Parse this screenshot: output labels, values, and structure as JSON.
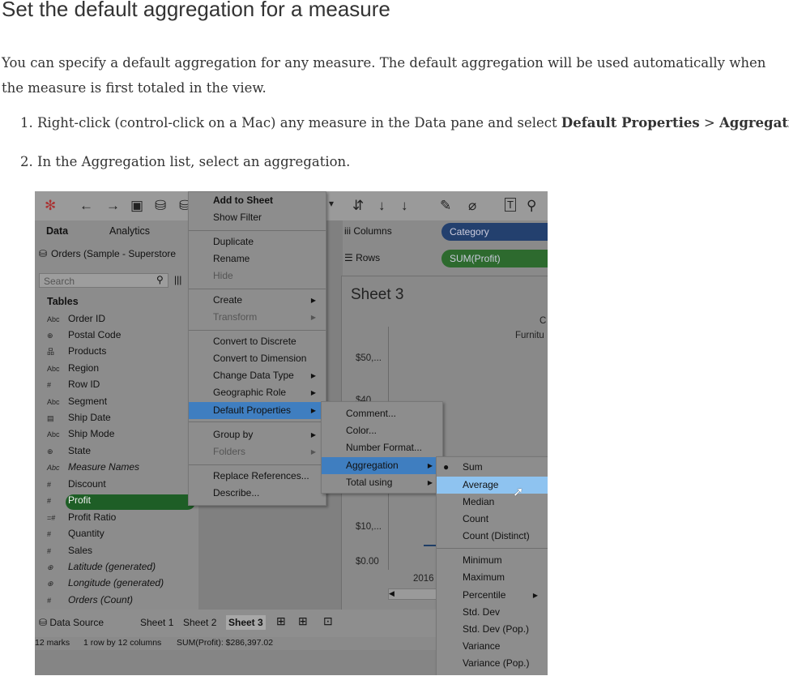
{
  "title": "Set the default aggregation for a measure",
  "intro": "You can specify a default aggregation for any measure. The default aggregation will be used automatically when the measure is first totaled in the view.",
  "steps": {
    "s1_num": "1.",
    "s1_pre": "Right-click (control-click on a Mac) any measure in the Data pane and select ",
    "s1_b1": "Default Properties",
    "s1_mid": " > ",
    "s1_b2": "Aggregation",
    "s1_end": ".",
    "s2_num": "2.",
    "s2_text": "In the Aggregation list, select an aggregation."
  },
  "shot": {
    "tabs": {
      "data": "Data",
      "analytics": "Analytics"
    },
    "data_source": "Orders (Sample - Superstore",
    "search_placeholder": "Search",
    "tables_heading": "Tables",
    "fields": [
      {
        "icon": "Abc",
        "label": "Order ID"
      },
      {
        "icon": "⊕",
        "label": "Postal Code"
      },
      {
        "icon": "品",
        "label": "Products"
      },
      {
        "icon": "Abc",
        "label": "Region"
      },
      {
        "icon": "#",
        "label": "Row ID"
      },
      {
        "icon": "Abc",
        "label": "Segment"
      },
      {
        "icon": "▤",
        "label": "Ship Date"
      },
      {
        "icon": "Abc",
        "label": "Ship Mode"
      },
      {
        "icon": "⊕",
        "label": "State"
      },
      {
        "icon": "Abc",
        "label": "Measure Names"
      },
      {
        "icon": "#",
        "label": "Discount"
      },
      {
        "icon": "#",
        "label": "Profit"
      },
      {
        "icon": "=#",
        "label": "Profit Ratio"
      },
      {
        "icon": "#",
        "label": "Quantity"
      },
      {
        "icon": "#",
        "label": "Sales"
      },
      {
        "icon": "⊕",
        "label": "Latitude (generated)"
      },
      {
        "icon": "⊕",
        "label": "Longitude (generated)"
      },
      {
        "icon": "#",
        "label": "Orders (Count)"
      }
    ],
    "shelves": {
      "columns": "Columns",
      "rows": "Rows",
      "col_pill": "Category",
      "row_pill": "SUM(Profit)"
    },
    "sheet_title": "Sheet 3",
    "axis": {
      "c": "C",
      "furn": "Furnitu",
      "v50": "$50,...",
      "v40": "$40,...",
      "v10": "$10,...",
      "v0": "$0.00",
      "year": "2016"
    },
    "bottom_tabs": {
      "data_source": "Data Source",
      "sheet1": "Sheet 1",
      "sheet2": "Sheet 2",
      "sheet3": "Sheet 3"
    },
    "status": {
      "marks": "12 marks",
      "rows": "1 row by 12 columns",
      "sum": "SUM(Profit): $286,397.02"
    },
    "menu1": {
      "add": "Add to Sheet",
      "show_filter": "Show Filter",
      "duplicate": "Duplicate",
      "rename": "Rename",
      "hide": "Hide",
      "create": "Create",
      "transform": "Transform",
      "to_discrete": "Convert to Discrete",
      "to_dimension": "Convert to Dimension",
      "change_type": "Change Data Type",
      "geo_role": "Geographic Role",
      "default_props": "Default Properties",
      "group_by": "Group by",
      "folders": "Folders",
      "replace_refs": "Replace References...",
      "describe": "Describe..."
    },
    "menu2": {
      "comment": "Comment...",
      "color": "Color...",
      "number_format": "Number Format...",
      "aggregation": "Aggregation",
      "total_using": "Total using"
    },
    "menu3": {
      "sum": "Sum",
      "average": "Average",
      "median": "Median",
      "count": "Count",
      "count_distinct": "Count (Distinct)",
      "minimum": "Minimum",
      "maximum": "Maximum",
      "percentile": "Percentile",
      "stddev": "Std. Dev",
      "stddev_pop": "Std. Dev (Pop.)",
      "variance": "Variance",
      "variance_pop": "Variance (Pop.)"
    }
  }
}
